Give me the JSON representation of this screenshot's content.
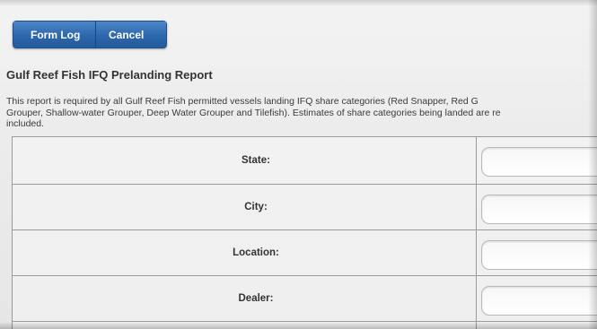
{
  "toolbar": {
    "form_log_label": "Form Log",
    "cancel_label": "Cancel"
  },
  "report": {
    "title": "Gulf Reef Fish IFQ Prelanding Report",
    "description_lines": [
      "This report is required by all Gulf Reef Fish permitted vessels landing IFQ share categories (Red Snapper, Red G",
      "Grouper, Shallow-water Grouper, Deep Water Grouper and Tilefish). Estimates of share categories being landed are re",
      "included."
    ]
  },
  "form": {
    "rows": [
      {
        "label": "State:",
        "value": ""
      },
      {
        "label": "City:",
        "value": ""
      },
      {
        "label": "Location:",
        "value": ""
      },
      {
        "label": "Dealer:",
        "value": ""
      }
    ]
  },
  "colors": {
    "button_blue": "#2d67ad",
    "button_text": "#ffffff",
    "background": "#ececec",
    "grid_line": "#9a9a9a"
  }
}
